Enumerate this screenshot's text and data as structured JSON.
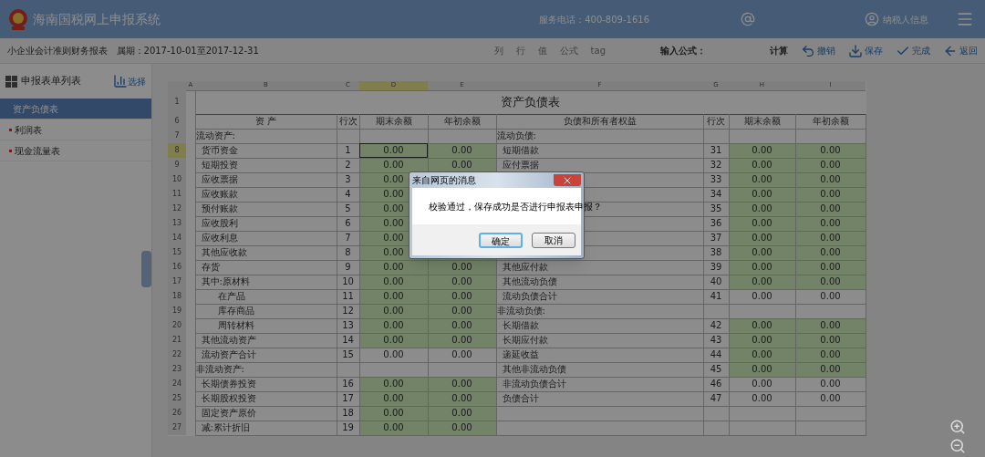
{
  "header": {
    "title": "海南国税网上申报系统",
    "hotline": "服务电话：400-809-1616",
    "user": "纳税人信息"
  },
  "report_bar": {
    "title": "小企业会计准则财务报表   属期：2017-10-01至2017-12-31",
    "tools": [
      "列",
      "行",
      "值",
      "公式",
      "tag"
    ],
    "formula_label": "输入公式：",
    "actions": [
      {
        "label": "计算",
        "kind": "text"
      },
      {
        "label": "撤销",
        "kind": "undo"
      },
      {
        "label": "保存",
        "kind": "save"
      },
      {
        "label": "完成",
        "kind": "done"
      },
      {
        "label": "返回",
        "kind": "back"
      }
    ]
  },
  "sidebar": {
    "title": "申报表单列表",
    "select": "选择",
    "items": [
      {
        "label": "资产负债表",
        "selected": true
      },
      {
        "label": "利润表",
        "selected": false
      },
      {
        "label": "现金流量表",
        "selected": false
      }
    ]
  },
  "sheet": {
    "columns": [
      {
        "label": "A",
        "selected": false
      },
      {
        "label": "B",
        "selected": false
      },
      {
        "label": "C",
        "selected": false
      },
      {
        "label": "D",
        "selected": true
      },
      {
        "label": "E",
        "selected": false
      },
      {
        "label": "F",
        "selected": false
      },
      {
        "label": "G",
        "selected": false
      },
      {
        "label": "H",
        "selected": false
      },
      {
        "label": "I",
        "selected": false
      }
    ],
    "title_row": "1",
    "title": "资产负债表",
    "header_row": "6",
    "headers": [
      "资 产",
      "行次",
      "期末余额",
      "年初余额",
      "负债和所有者权益",
      "行次",
      "期末余额",
      "年初余额"
    ],
    "rows": [
      {
        "row": "7",
        "selected": false,
        "left": {
          "kind": "section",
          "label": "流动资产:",
          "editable": false
        },
        "right": {
          "kind": "section",
          "label": "流动负债:",
          "editable": false
        }
      },
      {
        "row": "8",
        "selected": true,
        "left": {
          "kind": "item",
          "label": "货币资金",
          "line": "1",
          "end": "0.00",
          "begin": "0.00",
          "editable": true
        },
        "right": {
          "kind": "item",
          "label": "短期借款",
          "line": "31",
          "end": "0.00",
          "begin": "0.00",
          "editable": true
        }
      },
      {
        "row": "9",
        "selected": false,
        "left": {
          "kind": "item",
          "label": "短期投资",
          "line": "2",
          "end": "0.00",
          "begin": "0.00",
          "editable": true
        },
        "right": {
          "kind": "item",
          "label": "应付票据",
          "line": "32",
          "end": "0.00",
          "begin": "0.00",
          "editable": true
        }
      },
      {
        "row": "10",
        "selected": false,
        "left": {
          "kind": "item",
          "label": "应收票据",
          "line": "3",
          "end": "0.00",
          "editable": true
        },
        "right": {
          "kind": "item",
          "line": "33",
          "end": "0.00",
          "begin": "0.00",
          "editable": true
        }
      },
      {
        "row": "11",
        "selected": false,
        "left": {
          "kind": "item",
          "label": "应收账款",
          "line": "4",
          "end": "0.00",
          "editable": true
        },
        "right": {
          "kind": "item",
          "line": "34",
          "end": "0.00",
          "begin": "0.00",
          "editable": true
        }
      },
      {
        "row": "12",
        "selected": false,
        "left": {
          "kind": "item",
          "label": "预付账款",
          "line": "5",
          "end": "0.00",
          "editable": true
        },
        "right": {
          "kind": "item",
          "line": "35",
          "end": "0.00",
          "begin": "0.00",
          "editable": true
        }
      },
      {
        "row": "13",
        "selected": false,
        "left": {
          "kind": "item",
          "label": "应收股利",
          "line": "6",
          "end": "0.00",
          "editable": true
        },
        "right": {
          "kind": "item",
          "line": "36",
          "end": "0.00",
          "begin": "0.00",
          "editable": true
        }
      },
      {
        "row": "14",
        "selected": false,
        "left": {
          "kind": "item",
          "label": "应收利息",
          "line": "7",
          "end": "0.00",
          "editable": true
        },
        "right": {
          "kind": "item",
          "line": "37",
          "end": "0.00",
          "begin": "0.00",
          "editable": true
        }
      },
      {
        "row": "15",
        "selected": false,
        "left": {
          "kind": "item",
          "label": "其他应收款",
          "line": "8",
          "end": "0.00",
          "editable": true
        },
        "right": {
          "kind": "item",
          "line": "38",
          "end": "0.00",
          "begin": "0.00",
          "editable": true
        }
      },
      {
        "row": "16",
        "selected": false,
        "left": {
          "kind": "item",
          "label": "存货",
          "line": "9",
          "end": "0.00",
          "begin": "0.00",
          "editable": true
        },
        "right": {
          "kind": "item",
          "label": "其他应付款",
          "line": "39",
          "end": "0.00",
          "begin": "0.00",
          "editable": true
        }
      },
      {
        "row": "17",
        "selected": false,
        "left": {
          "kind": "item",
          "label": "其中:原材料",
          "line": "10",
          "end": "0.00",
          "begin": "0.00",
          "editable": true
        },
        "right": {
          "kind": "item",
          "label": "其他流动负债",
          "line": "40",
          "end": "0.00",
          "begin": "0.00",
          "editable": true
        }
      },
      {
        "row": "18",
        "selected": false,
        "left": {
          "kind": "sub",
          "label": "在产品",
          "line": "11",
          "end": "0.00",
          "begin": "0.00",
          "editable": true
        },
        "right": {
          "kind": "item",
          "label": "流动负债合计",
          "line": "41",
          "end": "0.00",
          "begin": "0.00",
          "editable": false
        }
      },
      {
        "row": "19",
        "selected": false,
        "left": {
          "kind": "sub",
          "label": "库存商品",
          "line": "12",
          "end": "0.00",
          "begin": "0.00",
          "editable": true
        },
        "right": {
          "kind": "section",
          "label": "非流动负债:",
          "editable": false
        }
      },
      {
        "row": "20",
        "selected": false,
        "left": {
          "kind": "sub",
          "label": "周转材料",
          "line": "13",
          "end": "0.00",
          "begin": "0.00",
          "editable": true
        },
        "right": {
          "kind": "item",
          "label": "长期借款",
          "line": "42",
          "end": "0.00",
          "begin": "0.00",
          "editable": true
        }
      },
      {
        "row": "21",
        "selected": false,
        "left": {
          "kind": "item",
          "label": "其他流动资产",
          "line": "14",
          "end": "0.00",
          "begin": "0.00",
          "editable": true
        },
        "right": {
          "kind": "item",
          "label": "长期应付款",
          "line": "43",
          "end": "0.00",
          "begin": "0.00",
          "editable": true
        }
      },
      {
        "row": "22",
        "selected": false,
        "left": {
          "kind": "item",
          "label": "流动资产合计",
          "line": "15",
          "end": "0.00",
          "begin": "0.00",
          "editable": false
        },
        "right": {
          "kind": "item",
          "label": "递延收益",
          "line": "44",
          "end": "0.00",
          "begin": "0.00",
          "editable": true
        }
      },
      {
        "row": "23",
        "selected": false,
        "left": {
          "kind": "section",
          "label": "非流动资产:",
          "editable": false
        },
        "right": {
          "kind": "item",
          "label": "其他非流动负债",
          "line": "45",
          "end": "0.00",
          "begin": "0.00",
          "editable": true
        }
      },
      {
        "row": "24",
        "selected": false,
        "left": {
          "kind": "item",
          "label": "长期债券投资",
          "line": "16",
          "end": "0.00",
          "begin": "0.00",
          "editable": true
        },
        "right": {
          "kind": "item",
          "label": "非流动负债合计",
          "line": "46",
          "end": "0.00",
          "begin": "0.00",
          "editable": false
        }
      },
      {
        "row": "25",
        "selected": false,
        "left": {
          "kind": "item",
          "label": "长期股权投资",
          "line": "17",
          "end": "0.00",
          "begin": "0.00",
          "editable": true
        },
        "right": {
          "kind": "item",
          "label": "负债合计",
          "line": "47",
          "end": "0.00",
          "begin": "0.00",
          "editable": false
        }
      },
      {
        "row": "26",
        "selected": false,
        "left": {
          "kind": "item",
          "label": "固定资产原价",
          "line": "18",
          "end": "0.00",
          "begin": "0.00",
          "editable": true
        },
        "right": {
          "kind": "item",
          "editable": false
        }
      },
      {
        "row": "27",
        "selected": false,
        "left": {
          "kind": "item",
          "label": "减:累计折旧",
          "line": "19",
          "end": "0.00",
          "begin": "0.00",
          "editable": true
        },
        "right": {
          "kind": "item",
          "editable": false
        }
      }
    ]
  },
  "dialog": {
    "title": "来自网页的消息",
    "message": "校验通过，保存成功是否进行申报表申报？",
    "buttons": [
      {
        "label": "确定",
        "selected": true
      },
      {
        "label": "取消",
        "selected": false
      }
    ]
  }
}
